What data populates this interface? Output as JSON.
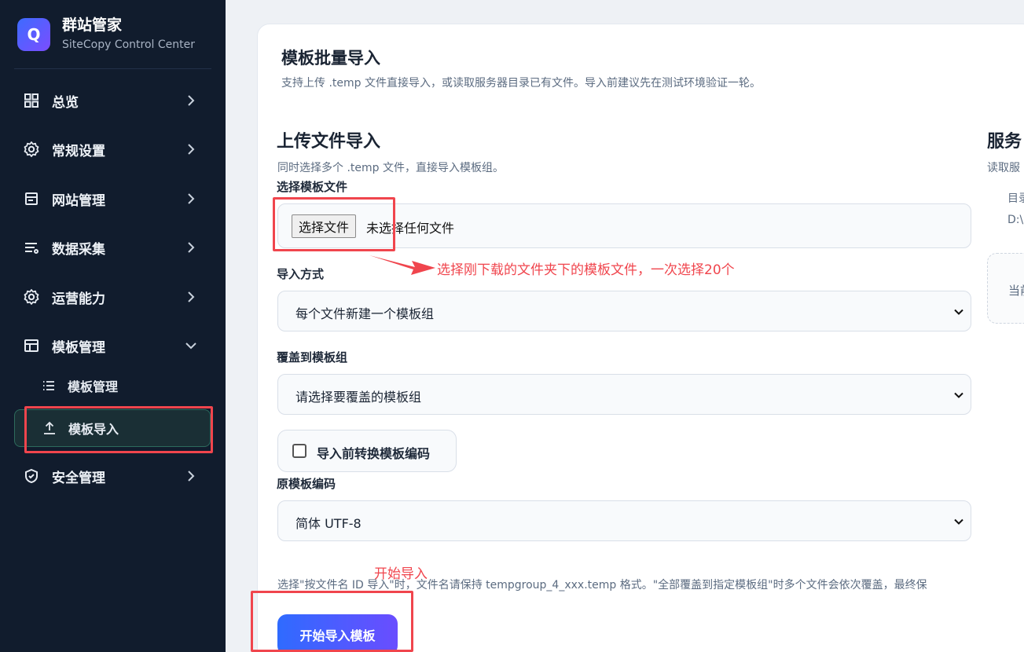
{
  "brand": {
    "logo_letter": "Q",
    "title": "群站管家",
    "subtitle": "SiteCopy Control Center"
  },
  "sidebar": {
    "items": [
      {
        "label": "总览",
        "icon": "grid-icon"
      },
      {
        "label": "常规设置",
        "icon": "gear-icon"
      },
      {
        "label": "网站管理",
        "icon": "browser-window-icon"
      },
      {
        "label": "数据采集",
        "icon": "list-filter-icon"
      },
      {
        "label": "运营能力",
        "icon": "gear-icon"
      },
      {
        "label": "模板管理",
        "icon": "layout-icon",
        "expanded": true
      },
      {
        "label": "安全管理",
        "icon": "shield-icon"
      }
    ],
    "subitems": [
      {
        "label": "模板管理",
        "icon": "list-icon"
      },
      {
        "label": "模板导入",
        "icon": "upload-icon",
        "active": true
      }
    ],
    "active_color": "#2d6b5d"
  },
  "page": {
    "title": "模板批量导入",
    "desc": "支持上传 .temp 文件直接导入，或读取服务器目录已有文件。导入前建议先在测试环境验证一轮。"
  },
  "upload": {
    "title": "上传文件导入",
    "desc": "同时选择多个 .temp 文件，直接导入模板组。",
    "file_label": "选择模板文件",
    "file_button": "选择文件",
    "file_status": "未选择任何文件",
    "mode_label": "导入方式",
    "mode_value": "每个文件新建一个模板组",
    "cover_label": "覆盖到模板组",
    "cover_value": "请选择要覆盖的模板组",
    "convert_label": "导入前转换模板编码",
    "convert_checked": false,
    "encoding_label": "原模板编码",
    "encoding_value": "简体 UTF-8",
    "hint": "选择\"按文件名 ID 导入\"时，文件名请保持 tempgroup_4_xxx.temp 格式。\"全部覆盖到指定模板组\"时多个文件会依次覆盖，最终保",
    "submit": "开始导入模板"
  },
  "server": {
    "title": "服务",
    "desc": "读取服",
    "line1": "目录",
    "line2": "D:\\",
    "box_text": "当前"
  },
  "annotations": {
    "file_note": "选择刚下载的文件夹下的模板文件，一次选择20个",
    "start_note": "开始导入",
    "color": "#f0454d"
  }
}
